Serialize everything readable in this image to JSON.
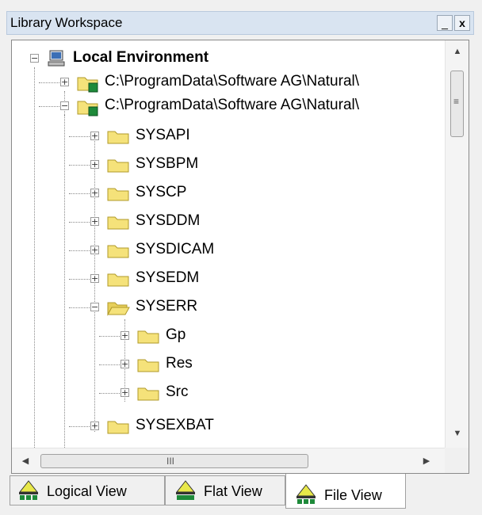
{
  "window": {
    "title": "Library Workspace",
    "min_label": "_",
    "close_label": "x"
  },
  "tree": {
    "root": {
      "label": "Local Environment",
      "expander": "−"
    },
    "nodes": [
      {
        "label": "C:\\ProgramData\\Software AG\\Natural\\",
        "expander": "+"
      },
      {
        "label": "C:\\ProgramData\\Software AG\\Natural\\",
        "expander": "−"
      },
      {
        "label": "SYSAPI",
        "expander": "+"
      },
      {
        "label": "SYSBPM",
        "expander": "+"
      },
      {
        "label": "SYSCP",
        "expander": "+"
      },
      {
        "label": "SYSDDM",
        "expander": "+"
      },
      {
        "label": "SYSDICAM",
        "expander": "+"
      },
      {
        "label": "SYSEDM",
        "expander": "+"
      },
      {
        "label": "SYSERR",
        "expander": "−"
      },
      {
        "label": "Gp",
        "expander": "+"
      },
      {
        "label": "Res",
        "expander": "+"
      },
      {
        "label": "Src",
        "expander": "+"
      },
      {
        "label": "SYSEXBAT",
        "expander": "+"
      }
    ]
  },
  "scrollbar": {
    "up": "▲",
    "down": "▼",
    "left": "◀",
    "right": "▶",
    "vgrip": "≡",
    "hgrip": "III"
  },
  "tabs": [
    {
      "label": "Logical View",
      "active": false
    },
    {
      "label": "Flat View",
      "active": false
    },
    {
      "label": "File View",
      "active": true
    }
  ],
  "colors": {
    "folder": "#f5e27a",
    "folder_edge": "#b09a2a",
    "badge": "#1e8a3a",
    "title_bg": "#d9e4f1"
  }
}
